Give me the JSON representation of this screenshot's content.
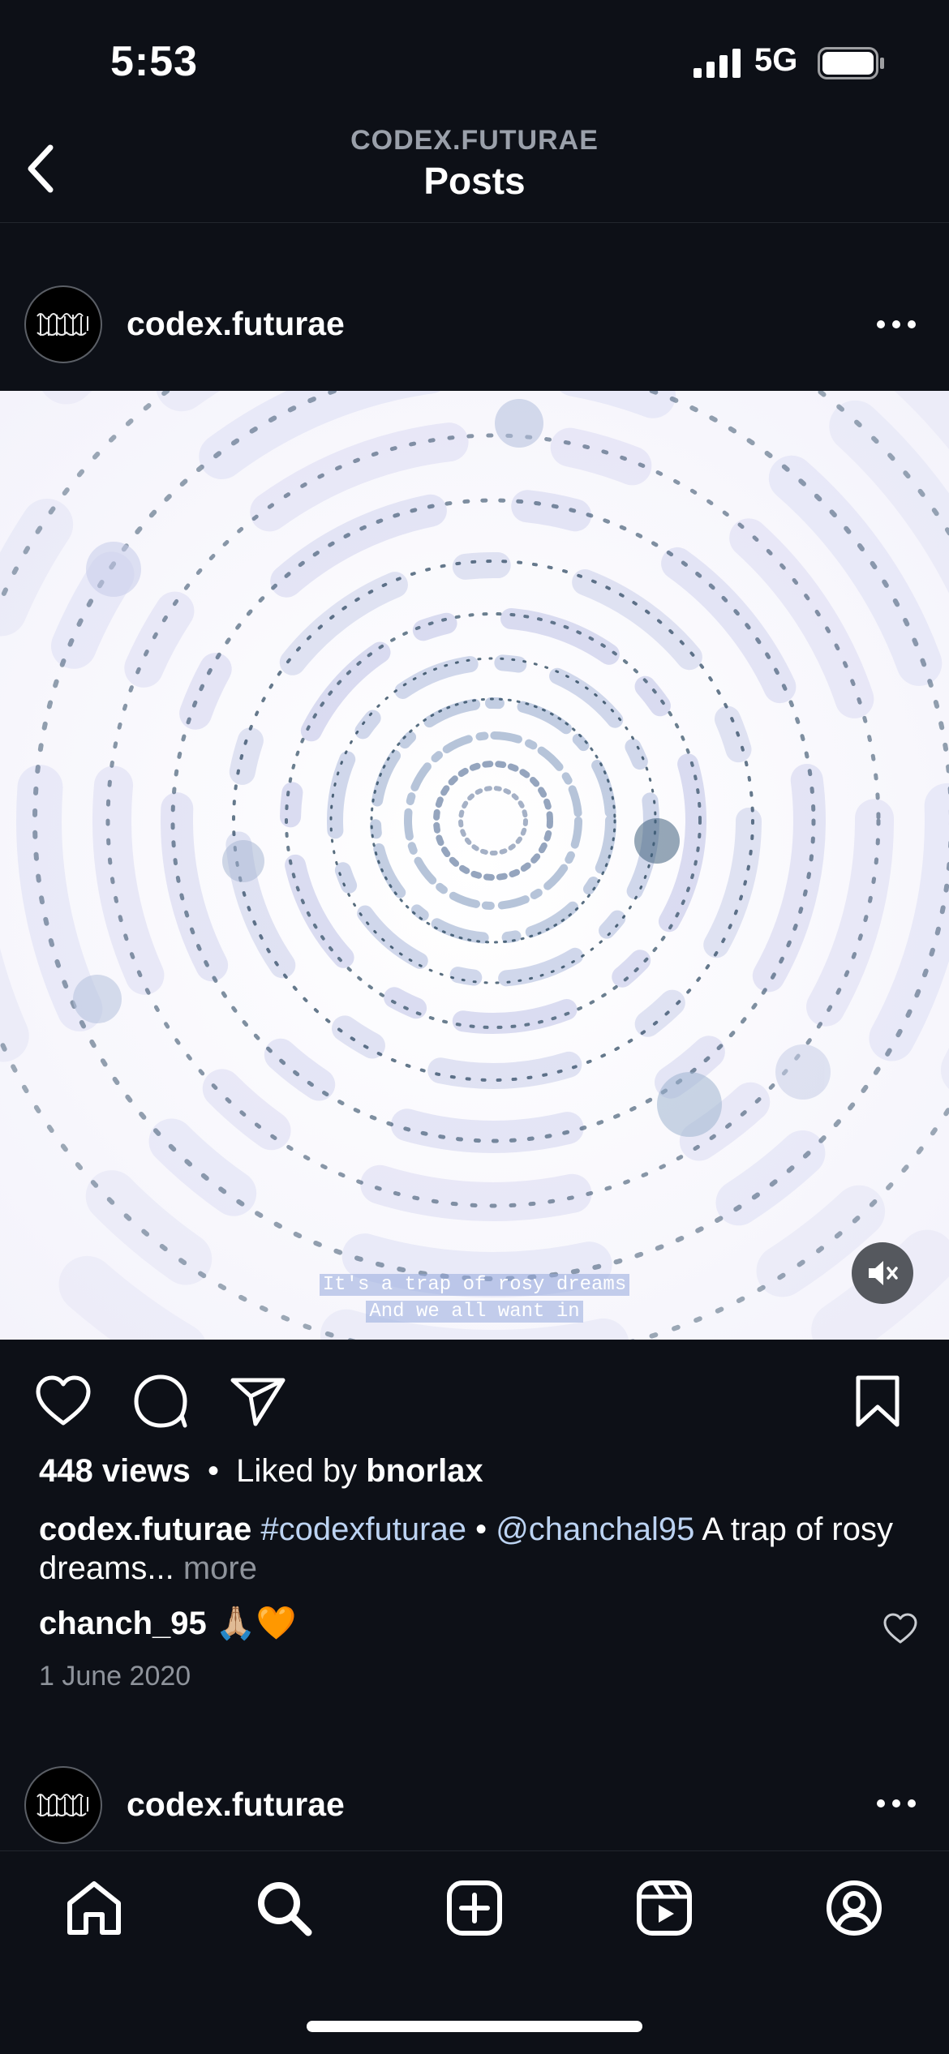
{
  "status_bar": {
    "time": "5:53",
    "network": "5G"
  },
  "header": {
    "subtitle": "CODEX.FUTURAE",
    "title": "Posts"
  },
  "posts": [
    {
      "username": "codex.futurae",
      "media_caption_lines": [
        "It's a trap of rosy dreams",
        "And we all want in"
      ],
      "views": "448 views",
      "separator": "•",
      "liked_by_prefix": "Liked by",
      "liked_by_user": "bnorlax",
      "caption": {
        "username": "codex.futurae",
        "hashtag": "#codexfuturae",
        "separator": "•",
        "mention": "@chanchal95",
        "text": "A trap of rosy dreams...",
        "more": "more"
      },
      "comment": {
        "username": "chanch_95",
        "text": "🙏🏼🧡"
      },
      "date": "1 June 2020"
    },
    {
      "username": "codex.futurae"
    }
  ],
  "colors": {
    "background": "#0d1017",
    "link": "#bcd3f2",
    "muted": "#8e939b"
  },
  "icons": [
    "back-icon",
    "more-icon",
    "mute-icon",
    "heart-icon",
    "comment-icon",
    "share-icon",
    "bookmark-icon",
    "home-icon",
    "search-icon",
    "create-icon",
    "reels-icon",
    "profile-icon"
  ]
}
